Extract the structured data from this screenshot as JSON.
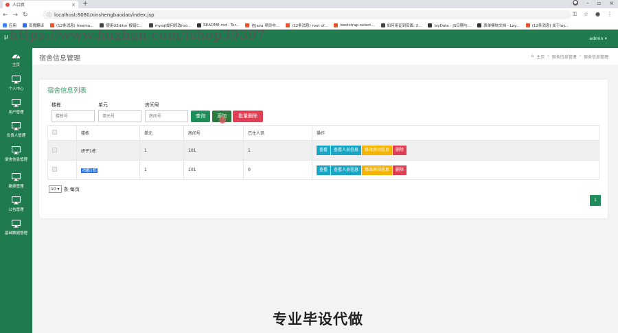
{
  "browser": {
    "tab_title": "人口页",
    "url": "localhost:8080/xinshengbaodao/index.jsp",
    "bookmarks": [
      {
        "label": "应用",
        "color": "#4285f4"
      },
      {
        "label": "百度翻译",
        "color": "#2f6ee5"
      },
      {
        "label": "(12条消息) freema...",
        "color": "#e8542c"
      },
      {
        "label": "使用UEditor 报错C...",
        "color": "#444"
      },
      {
        "label": "mysql如何修改roo...",
        "color": "#444"
      },
      {
        "label": "README.md - Ter...",
        "color": "#333"
      },
      {
        "label": "在java 项目中...",
        "color": "#e8542c"
      },
      {
        "label": "(12条消息) root of...",
        "color": "#e8542c"
      },
      {
        "label": "bootstrap-select...",
        "color": "#e8542c"
      },
      {
        "label": "如何用证到后面: 2...",
        "color": "#444"
      },
      {
        "label": "layDate - JS日期与...",
        "color": "#333"
      },
      {
        "label": "表单模块文档 - Lay...",
        "color": "#333"
      },
      {
        "label": "(12条消息) 关于lay...",
        "color": "#e8542c"
      }
    ]
  },
  "header": {
    "brand": "μ",
    "watermark": "https://www.huzhan.com/ishop39397",
    "user": "admin ▾"
  },
  "sidebar": {
    "items": [
      {
        "label": "主页",
        "icon": "dashboard-icon"
      },
      {
        "label": "个人中心",
        "icon": "monitor-icon"
      },
      {
        "label": "用户管理",
        "icon": "monitor-icon"
      },
      {
        "label": "负责人管理",
        "icon": "monitor-icon"
      },
      {
        "label": "宿舍信息管理",
        "icon": "monitor-icon"
      },
      {
        "label": "缴费管理",
        "icon": "monitor-icon"
      },
      {
        "label": "公告管理",
        "icon": "monitor-icon"
      },
      {
        "label": "基础数据管理",
        "icon": "monitor-icon"
      }
    ]
  },
  "page": {
    "title": "宿舍信息管理",
    "breadcrumb": [
      "主页",
      "宿舍信息管理",
      "宿舍信息管理"
    ]
  },
  "panel": {
    "title": "宿舍信息列表",
    "filters": [
      {
        "label": "楼栋",
        "placeholder": "楼栋号"
      },
      {
        "label": "单元",
        "placeholder": "单元号"
      },
      {
        "label": "房间号",
        "placeholder": "房间号"
      }
    ],
    "buttons": {
      "query": "查询",
      "add": "添加",
      "batch_delete": "批量删除"
    }
  },
  "table": {
    "headers": [
      "",
      "楼栋",
      "单元",
      "房间号",
      "已住人员",
      "操作"
    ],
    "rows": [
      {
        "building": "妍子1栋",
        "unit": "1",
        "room": "101",
        "occupants": "1"
      },
      {
        "building": "鸿鹏1栋",
        "unit": "1",
        "room": "101",
        "occupants": "0"
      }
    ],
    "actions": {
      "view": "查看",
      "view_people": "查看人员信息",
      "edit": "修改房间信息",
      "delete": "删除"
    }
  },
  "pagination": {
    "page_size": "10",
    "suffix": "条 每页",
    "current_page": "1"
  },
  "footer_text": "专业毕设代做"
}
